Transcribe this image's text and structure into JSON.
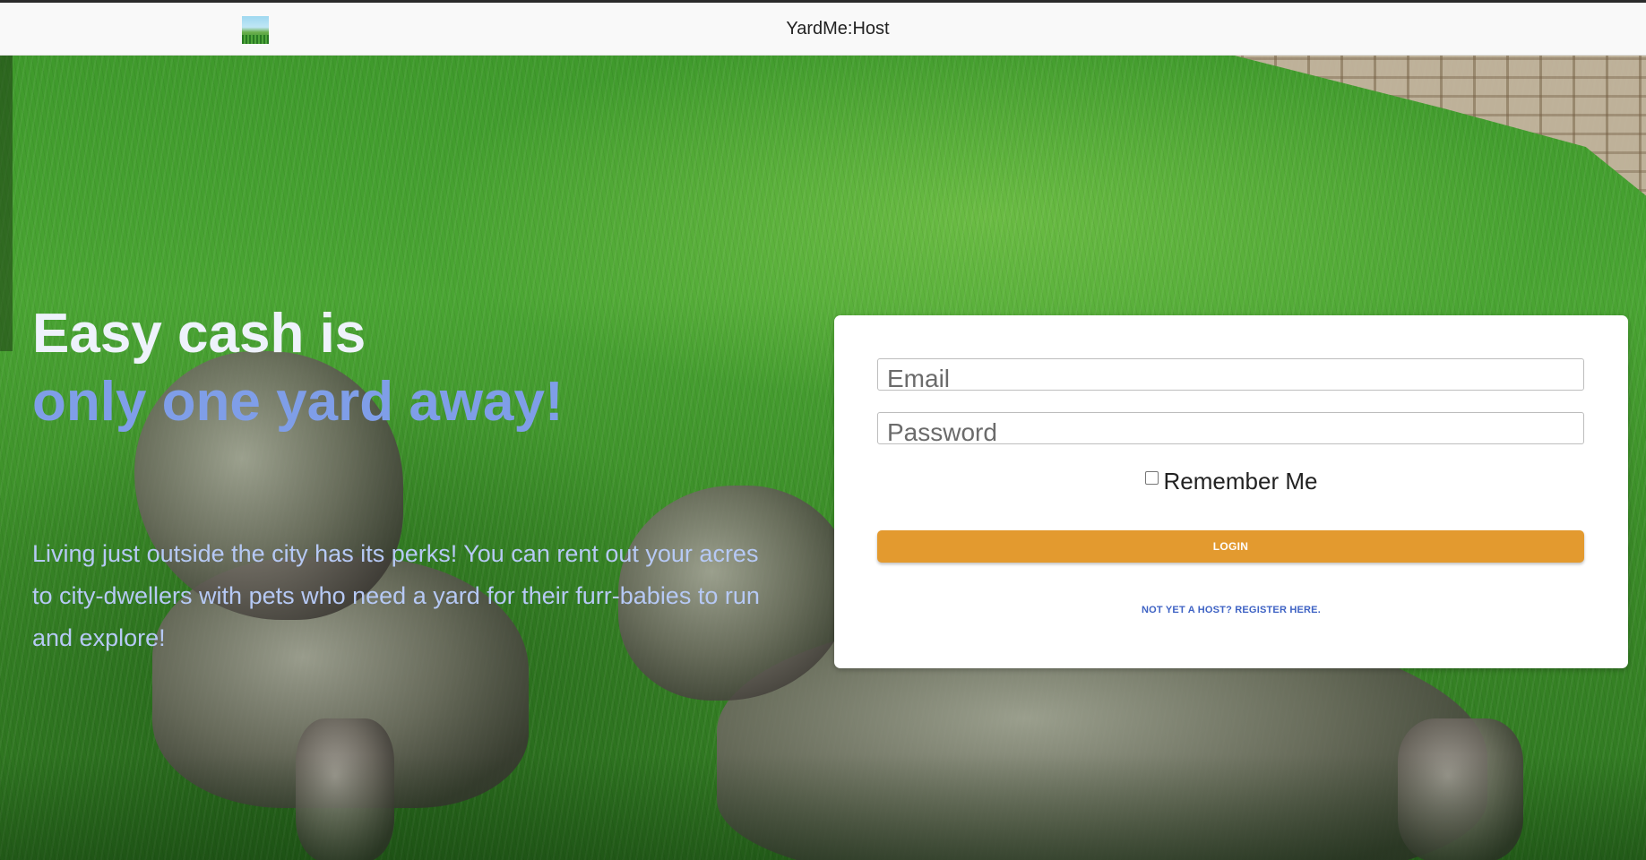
{
  "header": {
    "logo_icon": "yard-logo-icon",
    "app_title": "YardMe:Host"
  },
  "hero": {
    "headline_line1": "Easy cash is",
    "headline_line2": "only one yard away!",
    "description": "Living just outside the city has its perks! You can rent out your acres to city-dwellers with pets who need a yard for their furr-babies to run and explore!"
  },
  "login": {
    "email_placeholder": "Email",
    "password_placeholder": "Password",
    "remember_label": "Remember Me",
    "remember_checked": false,
    "login_label": "LOGIN",
    "register_link": "NOT YET A HOST? REGISTER HERE."
  },
  "colors": {
    "accent_orange": "#e39a2f",
    "headline_blue": "#7f9ee8",
    "link_blue": "#3f63c4"
  }
}
